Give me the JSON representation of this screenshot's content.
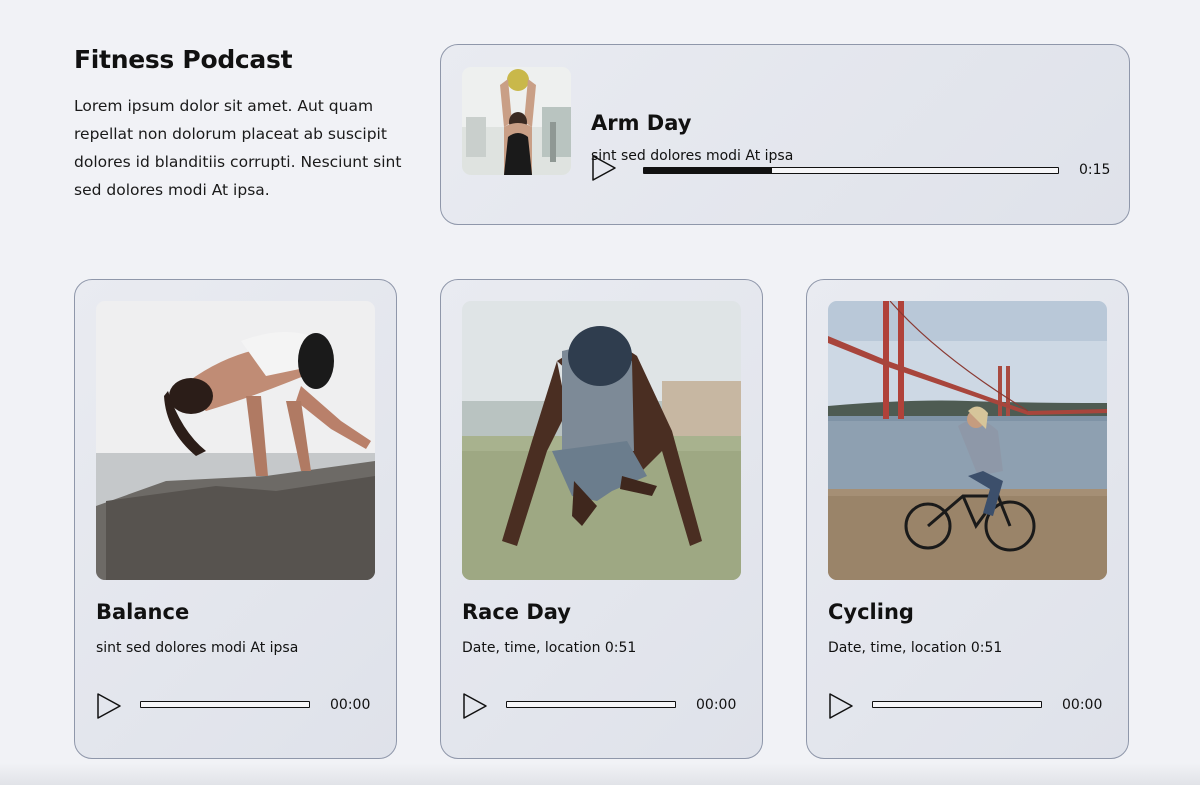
{
  "intro": {
    "title": "Fitness Podcast",
    "text": "Lorem ipsum dolor sit amet. Aut quam repellat non dolorum placeat ab suscipit dolores id blanditiis corrupti. Nesciunt sint sed dolores modi At ipsa."
  },
  "featured": {
    "title": "Arm Day",
    "subtitle": "sint sed dolores modi At ipsa",
    "time": "0:15",
    "progress": 0.31,
    "image": "arm-day-photo"
  },
  "episodes": [
    {
      "title": "Balance",
      "subtitle": "sint sed dolores modi At ipsa",
      "time": "00:00",
      "progress": 0,
      "image": "balance-photo"
    },
    {
      "title": "Race Day",
      "subtitle": "Date, time, location 0:51",
      "time": "00:00",
      "progress": 0,
      "image": "race-day-photo"
    },
    {
      "title": "Cycling",
      "subtitle": "Date, time, location 0:51",
      "time": "00:00",
      "progress": 0,
      "image": "cycling-photo"
    }
  ],
  "icons": {
    "play": "play-icon"
  },
  "colors": {
    "background": "#f1f2f6",
    "card_border": "#8f97aa",
    "text": "#111111"
  }
}
